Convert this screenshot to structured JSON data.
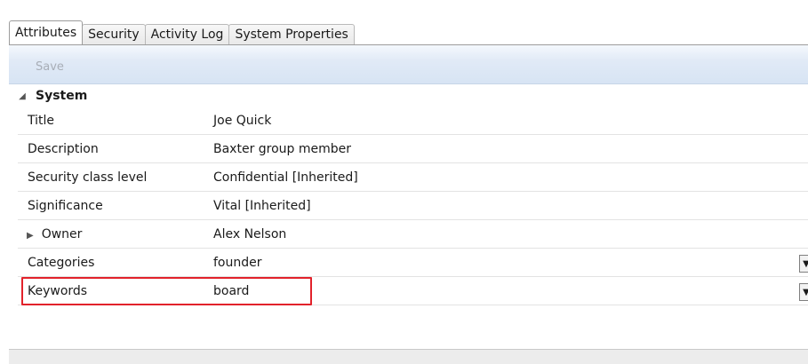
{
  "tabs": [
    {
      "label": "Attributes",
      "active": true
    },
    {
      "label": "Security",
      "active": false
    },
    {
      "label": "Activity Log",
      "active": false
    },
    {
      "label": "System Properties",
      "active": false
    }
  ],
  "toolbar": {
    "save_label": "Save",
    "save_enabled": false
  },
  "section": {
    "title": "System",
    "expanded": true,
    "toggle_icon": "triangle-down"
  },
  "properties": [
    {
      "name": "Title",
      "value": "Joe Quick"
    },
    {
      "name": "Description",
      "value": "Baxter group member"
    },
    {
      "name": "Security class level",
      "value": "Confidential [Inherited]"
    },
    {
      "name": "Significance",
      "value": "Vital [Inherited]"
    },
    {
      "name": "Owner",
      "value": "Alex Nelson",
      "expandable": true
    },
    {
      "name": "Categories",
      "value": "founder",
      "dropdown": true
    },
    {
      "name": "Keywords",
      "value": "board",
      "dropdown": true,
      "highlighted": true
    }
  ],
  "colors": {
    "highlight": "#e2222b",
    "toolbar": "#dbe6f4"
  }
}
